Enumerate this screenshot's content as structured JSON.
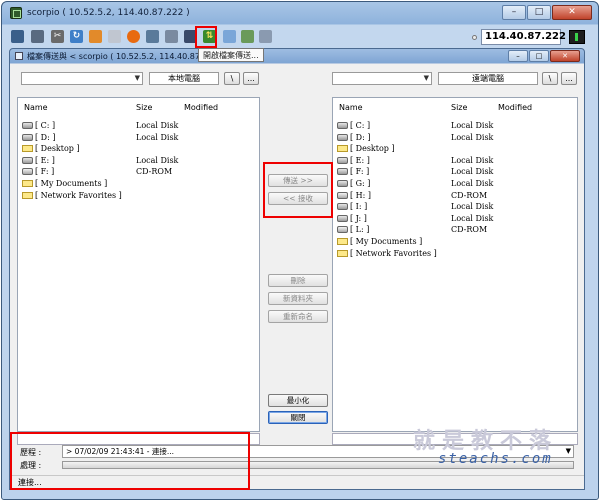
{
  "window": {
    "title": "scorpio ( 10.52.5.2, 114.40.87.222 )",
    "controls": [
      "–",
      "□",
      "✕"
    ]
  },
  "toolbar": {
    "host": "114.40.87.222",
    "tooltip": "開啟檔案傳送...",
    "icons": [
      "screen-icon",
      "options-icon",
      "tools-icon",
      "refresh-icon",
      "ctrl-alt-del-icon",
      "clipboard-icon",
      "stop-icon",
      "send-keys-icon",
      "fullscreen-icon",
      "monitor-icon",
      "file-transfer-icon",
      "chat-icon",
      "image-icon",
      "copy-icon"
    ]
  },
  "file_transfer": {
    "title": "檔案傳送與 < scorpio ( 10.52.5.2, 114.40.87.222 ) > ... NC",
    "local": {
      "path": "本地電腦",
      "up_btn": "\\",
      "more_btn": "...",
      "headers": {
        "name": "Name",
        "size": "Size",
        "modified": "Modified"
      },
      "rows": [
        {
          "name": "[ C: ]",
          "size": "Local Disk",
          "kind": "drive"
        },
        {
          "name": "[ D: ]",
          "size": "Local Disk",
          "kind": "drive"
        },
        {
          "name": "[ Desktop ]",
          "size": "",
          "kind": "folder"
        },
        {
          "name": "[ E: ]",
          "size": "Local Disk",
          "kind": "drive"
        },
        {
          "name": "[ F: ]",
          "size": "CD-ROM",
          "kind": "cdrom"
        },
        {
          "name": "[ My Documents ]",
          "size": "",
          "kind": "folder"
        },
        {
          "name": "[ Network Favorites ]",
          "size": "",
          "kind": "folder"
        }
      ]
    },
    "remote": {
      "path": "遠端電腦",
      "up_btn": "\\",
      "more_btn": "...",
      "headers": {
        "name": "Name",
        "size": "Size",
        "modified": "Modified"
      },
      "rows": [
        {
          "name": "[ C: ]",
          "size": "Local Disk",
          "kind": "drive"
        },
        {
          "name": "[ D: ]",
          "size": "Local Disk",
          "kind": "drive"
        },
        {
          "name": "[ Desktop ]",
          "size": "",
          "kind": "folder"
        },
        {
          "name": "[ E: ]",
          "size": "Local Disk",
          "kind": "drive"
        },
        {
          "name": "[ F: ]",
          "size": "Local Disk",
          "kind": "drive"
        },
        {
          "name": "[ G: ]",
          "size": "Local Disk",
          "kind": "drive"
        },
        {
          "name": "[ H: ]",
          "size": "CD-ROM",
          "kind": "cdrom"
        },
        {
          "name": "[ I: ]",
          "size": "Local Disk",
          "kind": "drive"
        },
        {
          "name": "[ J: ]",
          "size": "Local Disk",
          "kind": "drive"
        },
        {
          "name": "[ L: ]",
          "size": "CD-ROM",
          "kind": "cdrom"
        },
        {
          "name": "[ My Documents ]",
          "size": "",
          "kind": "folder"
        },
        {
          "name": "[ Network Favorites ]",
          "size": "",
          "kind": "folder"
        }
      ]
    },
    "buttons": {
      "send": "傳送 >>",
      "receive": "<< 接收",
      "delete": "刪除",
      "new_folder": "新資料夾",
      "rename": "重新命名",
      "minimize": "最小化",
      "close": "關閉"
    },
    "log": {
      "history_label": "歷程 :",
      "history_value": "> 07/02/09 21:43:41 - 連接...",
      "process_label": "處理 :"
    },
    "status": "連接..."
  },
  "watermark": {
    "line1": "就是教不落",
    "line2": "steachs.com"
  }
}
